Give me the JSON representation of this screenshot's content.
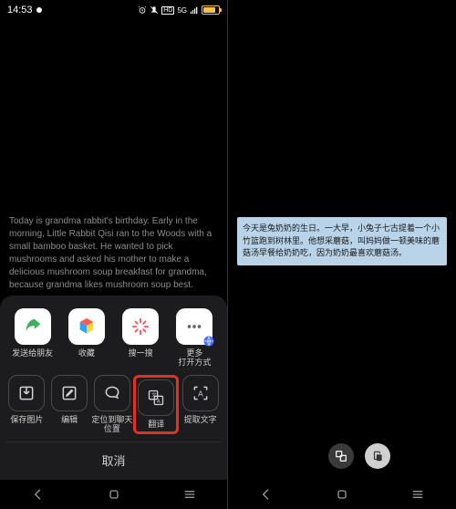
{
  "status": {
    "time": "14:53",
    "hd_label": "HD",
    "signal_label": "5G"
  },
  "left": {
    "selected_text": "Today is grandma rabbit's birthday. Early in the morning, Little Rabbit Qisi ran to the Woods with a small bamboo basket. He wanted to pick mushrooms and asked his mother to make a delicious mushroom soup breakfast for grandma, because grandma likes mushroom soup best."
  },
  "sheet": {
    "row1": [
      {
        "label": "发送给朋友"
      },
      {
        "label": "收藏"
      },
      {
        "label": "搜一搜"
      },
      {
        "label": "更多\n打开方式"
      }
    ],
    "row2": [
      {
        "label": "保存图片"
      },
      {
        "label": "编辑"
      },
      {
        "label": "定位到聊天\n位置"
      },
      {
        "label": "翻译"
      },
      {
        "label": "提取文字"
      }
    ],
    "cancel": "取消"
  },
  "right": {
    "translated_text": "今天是兔奶奶的生日。一大早，小兔子七古提着一个小竹篮跑到树林里。他想采蘑菇，叫妈妈做一顿美味的蘑菇汤早餐给奶奶吃，因为奶奶最喜欢蘑菇汤。"
  }
}
